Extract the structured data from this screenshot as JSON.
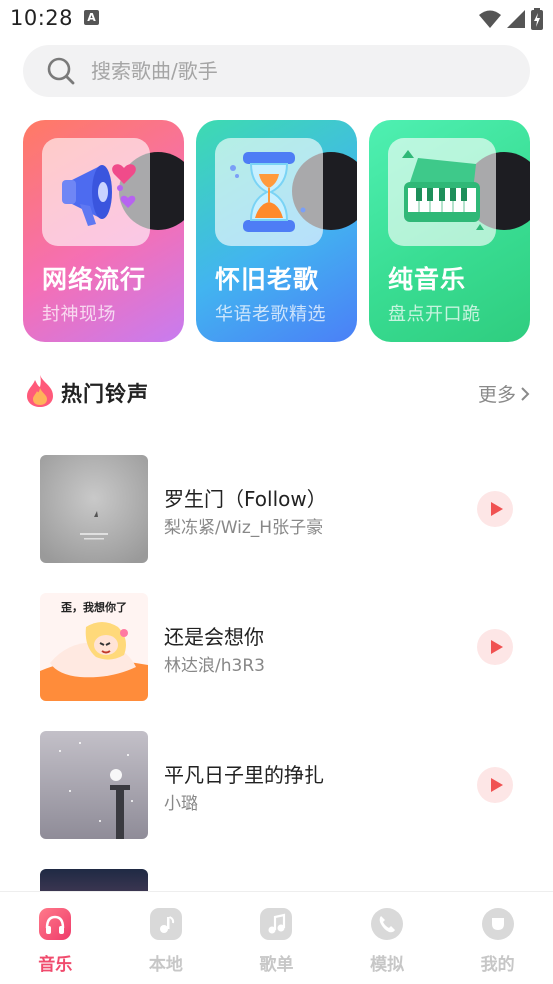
{
  "status_bar": {
    "time": "10:28",
    "notification_icon": "a-notification-icon",
    "icons": [
      "wifi-icon",
      "signal-icon",
      "battery-icon"
    ]
  },
  "search": {
    "placeholder": "搜索歌曲/歌手",
    "icon": "search-icon"
  },
  "categories": [
    {
      "title": "网络流行",
      "subtitle": "封神现场",
      "icon": "megaphone-icon",
      "colors": [
        "#ff7a63",
        "#c77cf0"
      ]
    },
    {
      "title": "怀旧老歌",
      "subtitle": "华语老歌精选",
      "icon": "hourglass-icon",
      "colors": [
        "#3ddbb0",
        "#4b7ff7"
      ]
    },
    {
      "title": "纯音乐",
      "subtitle": "盘点开口跪",
      "icon": "piano-icon",
      "colors": [
        "#4ff0b2",
        "#2fcd7f"
      ]
    }
  ],
  "ringtones": {
    "title": "热门铃声",
    "icon": "fire-icon",
    "more_label": "更多",
    "songs": [
      {
        "title": "罗生门（Follow）",
        "artist": "梨冻紧/Wiz_H张子豪",
        "cover": "grey-misty-cover"
      },
      {
        "title": "还是会想你",
        "artist": "林达浪/h3R3",
        "cover": "anime-girl-cover",
        "cover_text": "歪，我想你了"
      },
      {
        "title": "平凡日子里的挣扎",
        "artist": "小璐",
        "cover": "snowy-lamppost-cover"
      }
    ]
  },
  "bottom_nav": {
    "active": "音乐",
    "accent_color": "#f04b6d",
    "items": [
      {
        "label": "音乐",
        "icon": "music-app-icon"
      },
      {
        "label": "本地",
        "icon": "folder-note-icon"
      },
      {
        "label": "歌单",
        "icon": "playlist-icon"
      },
      {
        "label": "模拟",
        "icon": "phone-icon"
      },
      {
        "label": "我的",
        "icon": "profile-icon"
      }
    ]
  }
}
